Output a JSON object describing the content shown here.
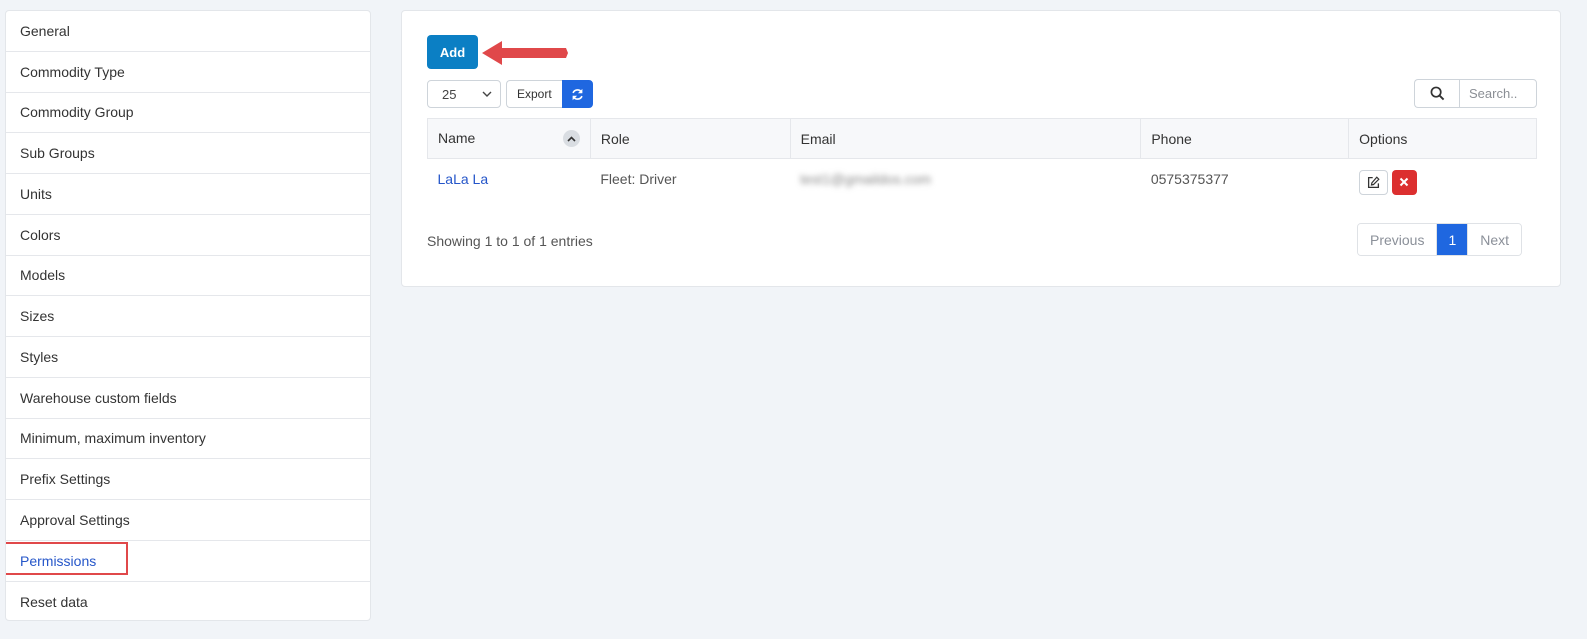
{
  "sidebar": {
    "items": [
      {
        "label": "General"
      },
      {
        "label": "Commodity Type"
      },
      {
        "label": "Commodity Group"
      },
      {
        "label": "Sub Groups"
      },
      {
        "label": "Units"
      },
      {
        "label": "Colors"
      },
      {
        "label": "Models"
      },
      {
        "label": "Sizes"
      },
      {
        "label": "Styles"
      },
      {
        "label": "Warehouse custom fields"
      },
      {
        "label": "Minimum, maximum inventory"
      },
      {
        "label": "Prefix Settings"
      },
      {
        "label": "Approval Settings"
      },
      {
        "label": "Permissions"
      },
      {
        "label": "Reset data"
      }
    ],
    "active_label": "Permissions"
  },
  "toolbar": {
    "add_label": "Add",
    "page_size": "25",
    "export_label": "Export",
    "search_placeholder": "Search.."
  },
  "table": {
    "columns": [
      "Name",
      "Role",
      "Email",
      "Phone",
      "Options"
    ],
    "rows": [
      {
        "name": "LaLa La",
        "role": "Fleet: Driver",
        "email": "test1@gmaildos.com",
        "phone": "0575375377"
      }
    ]
  },
  "footer": {
    "info": "Showing 1 to 1 of 1 entries",
    "prev_label": "Previous",
    "current_page": "1",
    "next_label": "Next"
  },
  "colors": {
    "primary": "#0b7fc4",
    "accent": "#1f67e0",
    "danger": "#dc2f2f",
    "annotation": "#e0484a",
    "link": "#2556c9"
  }
}
